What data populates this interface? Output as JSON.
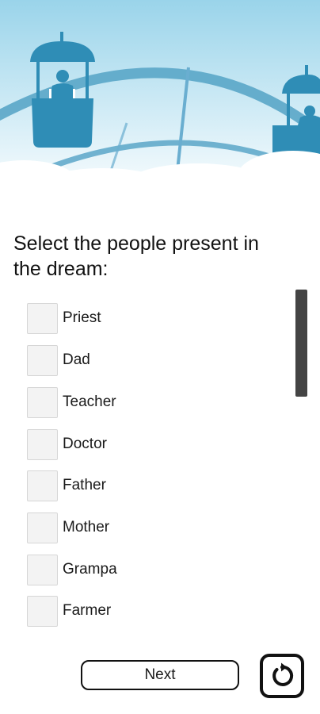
{
  "question": {
    "title": "Select the people present in the dream:"
  },
  "options": [
    {
      "label": "Priest",
      "checked": false
    },
    {
      "label": "Dad",
      "checked": false
    },
    {
      "label": "Teacher",
      "checked": false
    },
    {
      "label": "Doctor",
      "checked": false
    },
    {
      "label": "Father",
      "checked": false
    },
    {
      "label": "Mother",
      "checked": false
    },
    {
      "label": "Grampa",
      "checked": false
    },
    {
      "label": "Farmer",
      "checked": false
    }
  ],
  "actions": {
    "next_label": "Next",
    "reset_icon": "restart-icon"
  },
  "colors": {
    "sky_top": "#9fd6ea",
    "sky_bottom": "#ffffff",
    "gondola": "#2f8db6",
    "wheel": "#4a9cc2",
    "checkbox_fill": "#f3f3f3"
  }
}
